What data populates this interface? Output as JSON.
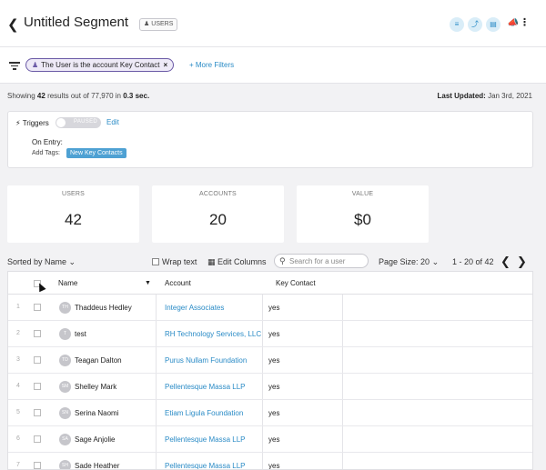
{
  "header": {
    "back_icon": "chevron-left-icon",
    "title": "Untitled Segment",
    "users_tag": "USERS",
    "icons": [
      "filter-icon",
      "lightning-icon",
      "database-icon",
      "megaphone-icon",
      "more-vertical-icon"
    ],
    "accent_color": "#2a8bc6"
  },
  "filters": {
    "chip_label": "The User is the account Key Contact",
    "more_filters": "+ More Filters"
  },
  "results": {
    "showing_prefix": "Showing",
    "count": "42",
    "mid": "results out of 77,970 in",
    "time": "0.3 sec.",
    "last_updated_label": "Last Updated:",
    "last_updated_value": "Jan 3rd, 2021"
  },
  "triggers": {
    "label": "Triggers",
    "toggle_state": "PAUSED",
    "edit": "Edit",
    "on_entry": "On Entry:",
    "add_tags": "Add Tags:",
    "tag": "New Key Contacts"
  },
  "stats": [
    {
      "label": "USERS",
      "value": "42"
    },
    {
      "label": "ACCOUNTS",
      "value": "20"
    },
    {
      "label": "VALUE",
      "value": "$0"
    }
  ],
  "toolbar": {
    "sorted_by": "Sorted by Name",
    "wrap_text": "Wrap text",
    "edit_columns": "Edit Columns",
    "search_placeholder": "Search for a user",
    "page_size": "Page Size: 20",
    "pagination": "1 - 20 of 42"
  },
  "table": {
    "columns": [
      "Name",
      "Account",
      "Key Contact"
    ],
    "rows": [
      {
        "num": "1",
        "initials": "TH",
        "name": "Thaddeus Hedley",
        "account": "Integer Associates",
        "key": "yes"
      },
      {
        "num": "2",
        "initials": "T",
        "name": "test",
        "account": "RH Technology Services, LLC",
        "key": "yes"
      },
      {
        "num": "3",
        "initials": "TD",
        "name": "Teagan Dalton",
        "account": "Purus Nullam Foundation",
        "key": "yes"
      },
      {
        "num": "4",
        "initials": "SM",
        "name": "Shelley Mark",
        "account": "Pellentesque Massa LLP",
        "key": "yes"
      },
      {
        "num": "5",
        "initials": "SN",
        "name": "Serina Naomi",
        "account": "Etiam Ligula Foundation",
        "key": "yes"
      },
      {
        "num": "6",
        "initials": "SA",
        "name": "Sage Anjolie",
        "account": "Pellentesque Massa LLP",
        "key": "yes"
      },
      {
        "num": "7",
        "initials": "SH",
        "name": "Sade Heather",
        "account": "Pellentesque Massa LLP",
        "key": "yes"
      }
    ]
  }
}
